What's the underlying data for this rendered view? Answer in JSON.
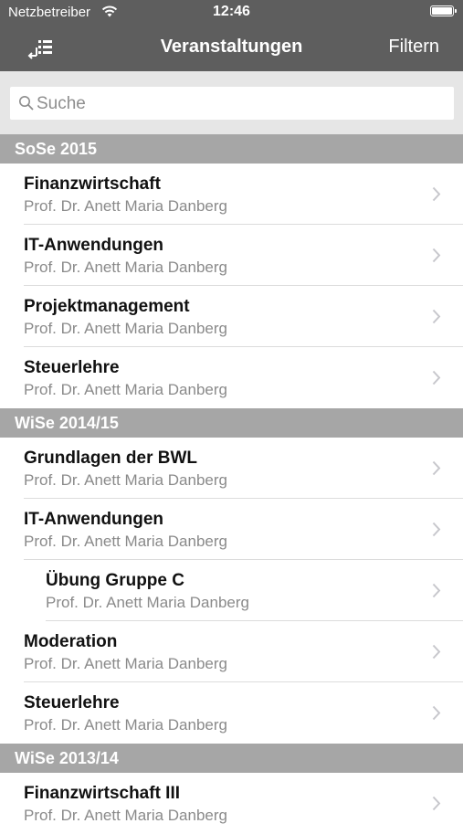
{
  "status_bar": {
    "carrier": "Netzbetreiber",
    "time": "12:46",
    "wifi_icon": "wifi-icon",
    "battery_icon": "battery-icon"
  },
  "nav": {
    "menu_icon": "list-menu-icon",
    "title": "Veranstaltungen",
    "filter_label": "Filtern"
  },
  "search": {
    "placeholder": "Suche",
    "value": ""
  },
  "sections": [
    {
      "header": "SoSe 2015",
      "items": [
        {
          "title": "Finanzwirtschaft",
          "subtitle": "Prof. Dr. Anett Maria Danberg",
          "indent": false
        },
        {
          "title": "IT-Anwendungen",
          "subtitle": "Prof. Dr. Anett Maria Danberg",
          "indent": false
        },
        {
          "title": "Projektmanagement",
          "subtitle": "Prof. Dr. Anett Maria Danberg",
          "indent": false
        },
        {
          "title": "Steuerlehre",
          "subtitle": "Prof. Dr. Anett Maria Danberg",
          "indent": false
        }
      ]
    },
    {
      "header": "WiSe 2014/15",
      "items": [
        {
          "title": "Grundlagen der BWL",
          "subtitle": "Prof. Dr. Anett Maria Danberg",
          "indent": false
        },
        {
          "title": "IT-Anwendungen",
          "subtitle": "Prof. Dr. Anett Maria Danberg",
          "indent": false
        },
        {
          "title": "Übung Gruppe C",
          "subtitle": "Prof. Dr. Anett Maria Danberg",
          "indent": true
        },
        {
          "title": "Moderation",
          "subtitle": "Prof. Dr. Anett Maria Danberg",
          "indent": false
        },
        {
          "title": "Steuerlehre",
          "subtitle": "Prof. Dr. Anett Maria Danberg",
          "indent": false
        }
      ]
    },
    {
      "header": "WiSe 2013/14",
      "items": [
        {
          "title": "Finanzwirtschaft III",
          "subtitle": "Prof. Dr. Anett Maria Danberg",
          "indent": false
        }
      ]
    }
  ],
  "colors": {
    "bar_background": "#5e5e5e",
    "section_header": "#a6a6a6",
    "subtitle_text": "#8a8a8a",
    "chevron": "#c7c7cc"
  }
}
